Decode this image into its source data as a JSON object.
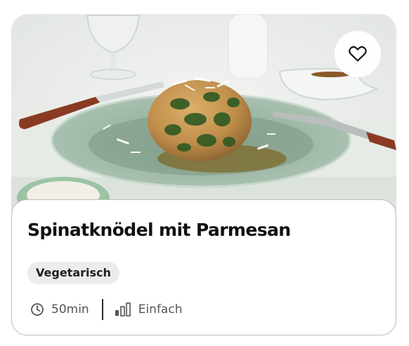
{
  "recipe": {
    "title": "Spinatknödel mit Parmesan",
    "tag": "Vegetarisch",
    "time": "50min",
    "difficulty": "Einfach",
    "difficulty_level": 1,
    "difficulty_max": 3,
    "favorite_icon": "heart-outline-icon",
    "time_icon": "clock-icon",
    "difficulty_icon": "difficulty-bars-icon"
  },
  "colors": {
    "text": "#111111",
    "meta_text": "#555555",
    "tag_background": "#ececec",
    "card_border": "#bdbdbd",
    "plate": "#9bb5a4"
  }
}
